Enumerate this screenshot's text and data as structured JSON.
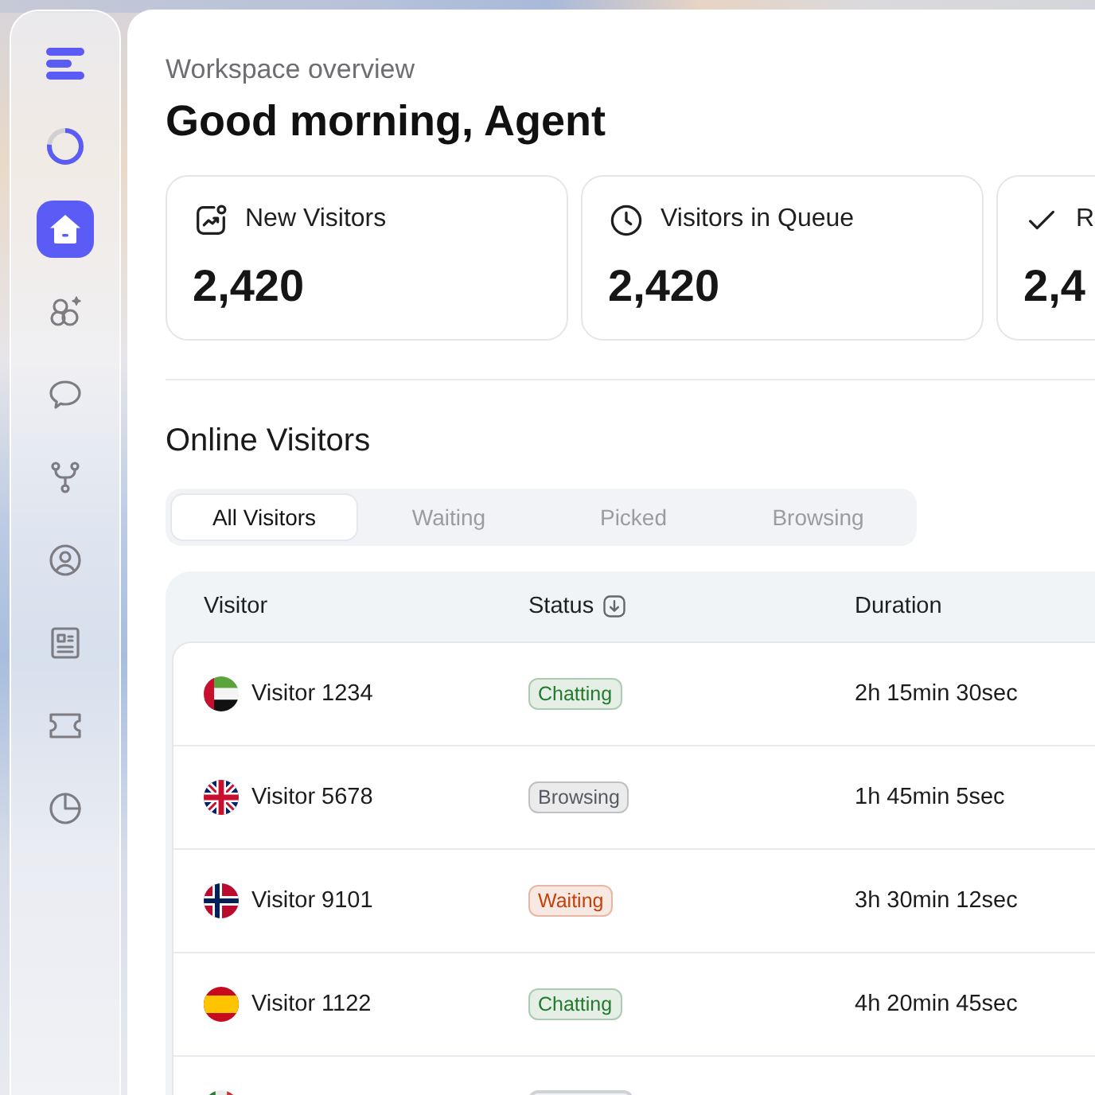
{
  "sidebar": {
    "items": [
      {
        "selected": true
      },
      {
        "selected": false
      },
      {
        "selected": false
      },
      {
        "selected": false
      },
      {
        "selected": false
      },
      {
        "selected": false
      },
      {
        "selected": false
      },
      {
        "selected": false
      }
    ]
  },
  "header": {
    "subtitle": "Workspace overview",
    "title": "Good morning, Agent"
  },
  "stats": [
    {
      "label": "New Visitors",
      "value": "2,420"
    },
    {
      "label": "Visitors in Queue",
      "value": "2,420"
    },
    {
      "label": "R",
      "value": "2,4"
    }
  ],
  "online_visitors": {
    "title": "Online Visitors",
    "tabs": [
      {
        "label": "All Visitors",
        "selected": true
      },
      {
        "label": "Waiting",
        "selected": false
      },
      {
        "label": "Picked",
        "selected": false
      },
      {
        "label": "Browsing",
        "selected": false
      }
    ],
    "table": {
      "columns": [
        {
          "label": "Visitor",
          "sorted": false
        },
        {
          "label": "Status",
          "sorted": true
        },
        {
          "label": "Duration",
          "sorted": false
        }
      ],
      "rows": [
        {
          "visitor": "Visitor 1234",
          "status": {
            "label": "Chatting",
            "color": "#237a2f"
          },
          "duration": "2h 15min 30sec"
        },
        {
          "visitor": "Visitor 5678",
          "status": {
            "label": "Browsing",
            "color": "#555a63"
          },
          "duration": "1h 45min 5sec"
        },
        {
          "visitor": "Visitor 9101",
          "status": {
            "label": "Waiting",
            "color": "#c2410c"
          },
          "duration": "3h 30min 12sec"
        },
        {
          "visitor": "Visitor 1122",
          "status": {
            "label": "Chatting",
            "color": "#237a2f"
          },
          "duration": "4h 20min 45sec"
        },
        {
          "status": {
            "color": "#cfd2d8"
          }
        }
      ]
    }
  }
}
